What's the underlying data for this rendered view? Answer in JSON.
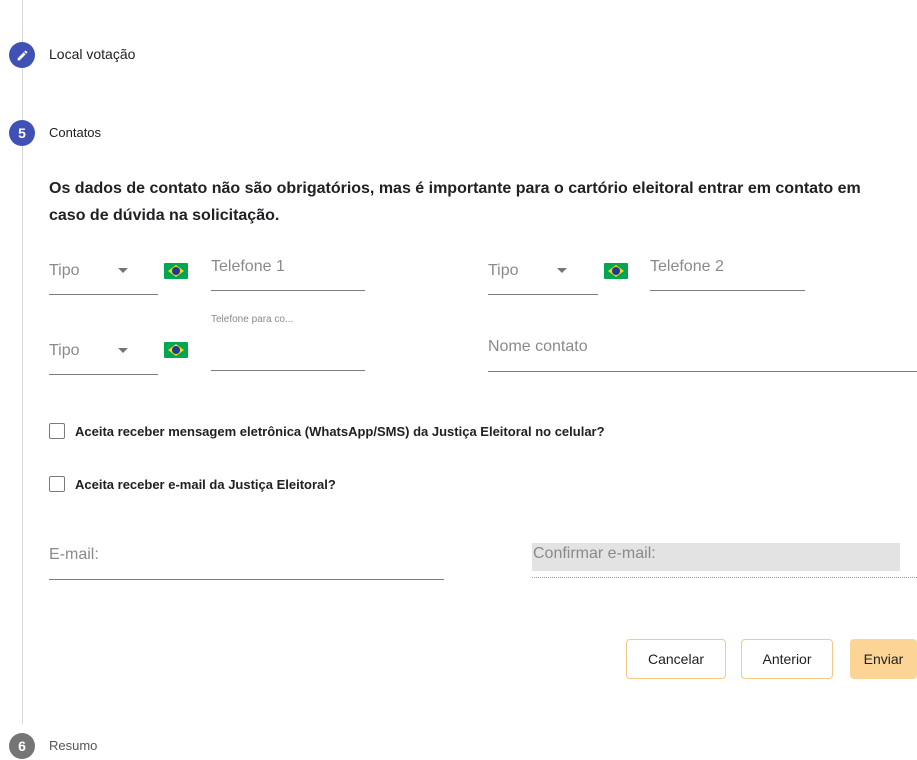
{
  "steps": {
    "local": {
      "label": "Local votação",
      "icon": "pencil-icon"
    },
    "contatos": {
      "number": "5",
      "label": "Contatos"
    },
    "resumo": {
      "number": "6",
      "label": "Resumo"
    }
  },
  "intro_text": "Os dados de contato não são obrigatórios, mas é importante para o cartório eleitoral entrar em contato em caso de dúvida na solicitação.",
  "phones": [
    {
      "tipo": "Tipo",
      "placeholder": "Telefone 1",
      "flag": "brazil-flag-icon"
    },
    {
      "tipo": "Tipo",
      "placeholder": "Telefone 2",
      "flag": "brazil-flag-icon"
    },
    {
      "tipo": "Tipo",
      "float_label": "Telefone para co...",
      "value": "",
      "flag": "brazil-flag-icon"
    }
  ],
  "nome_contato": {
    "placeholder": "Nome contato"
  },
  "checkboxes": [
    {
      "label": "Aceita receber mensagem eletrônica (WhatsApp/SMS) da Justiça Eleitoral no celular?",
      "checked": false
    },
    {
      "label": "Aceita receber e-mail da Justiça Eleitoral?",
      "checked": false
    }
  ],
  "email": {
    "placeholder": "E-mail:"
  },
  "confirm_email": {
    "placeholder": "Confirmar e-mail:"
  },
  "buttons": {
    "cancel": "Cancelar",
    "previous": "Anterior",
    "submit": "Enviar"
  },
  "colors": {
    "step_active": "#3f51b5",
    "step_inactive": "#757575",
    "button_border": "#f6c887",
    "button_primary": "#fbd496"
  }
}
